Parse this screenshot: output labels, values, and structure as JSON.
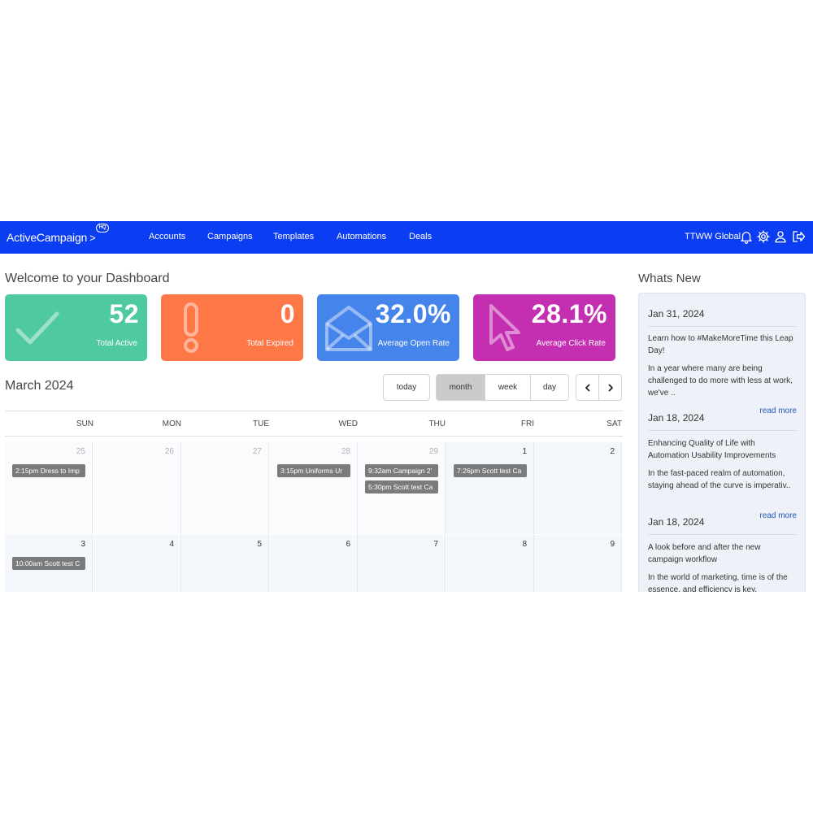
{
  "nav": {
    "brand": "ActiveCampaign",
    "brand_chevron": ">",
    "badge": "HQ",
    "links": [
      "Accounts",
      "Campaigns",
      "Templates",
      "Automations",
      "Deals"
    ],
    "org": "TTWW Global",
    "icons": [
      "bell-icon",
      "gear-icon",
      "user-icon",
      "logout-icon"
    ]
  },
  "dashboard": {
    "title": "Welcome to your Dashboard",
    "cards": [
      {
        "value": "52",
        "label": "Total Active",
        "color": "#4fc9a1",
        "icon": "checkmark-icon"
      },
      {
        "value": "0",
        "label": "Total Expired",
        "color": "#fd7846",
        "icon": "exclamation-icon"
      },
      {
        "value": "32.0%",
        "label": "Average Open Rate",
        "color": "#4584ea",
        "icon": "envelope-open-icon"
      },
      {
        "value": "28.1%",
        "label": "Average Click Rate",
        "color": "#c32fb0",
        "icon": "cursor-pointer-icon"
      }
    ]
  },
  "calendar": {
    "title": "March 2024",
    "buttons": {
      "today": "today",
      "month": "month",
      "week": "week",
      "day": "day"
    },
    "nav_icons": [
      "chevron-left-icon",
      "chevron-right-icon"
    ],
    "weekdays": [
      "SUN",
      "MON",
      "TUE",
      "WED",
      "THU",
      "FRI",
      "SAT"
    ],
    "weeks": [
      [
        {
          "day": "25",
          "other": true,
          "events": [
            "2:15pm Dress to Imp"
          ]
        },
        {
          "day": "26",
          "other": true,
          "events": []
        },
        {
          "day": "27",
          "other": true,
          "events": []
        },
        {
          "day": "28",
          "other": true,
          "events": [
            "3:15pm Uniforms Ur"
          ]
        },
        {
          "day": "29",
          "other": true,
          "events": [
            "9:32am Campaign 2'",
            "5:30pm Scott test Ca"
          ]
        },
        {
          "day": "1",
          "other": false,
          "events": [
            "7:26pm Scott test Ca"
          ]
        },
        {
          "day": "2",
          "other": false,
          "events": []
        }
      ],
      [
        {
          "day": "3",
          "other": false,
          "events": [
            "10:00am Scott test C"
          ]
        },
        {
          "day": "4",
          "other": false,
          "events": []
        },
        {
          "day": "5",
          "other": false,
          "events": []
        },
        {
          "day": "6",
          "other": false,
          "events": []
        },
        {
          "day": "7",
          "other": false,
          "events": []
        },
        {
          "day": "8",
          "other": false,
          "events": []
        },
        {
          "day": "9",
          "other": false,
          "events": []
        }
      ]
    ]
  },
  "whats_new": {
    "title": "Whats New",
    "posts": [
      {
        "date": "Jan 31, 2024",
        "headline": "Learn how to #MakeMoreTime this Leap Day!",
        "excerpt": "In a year where many are being challenged to do more with less at work, we've ..",
        "read_more": "read more"
      },
      {
        "date": "Jan 18, 2024",
        "headline": "Enhancing Quality of Life with Automation Usability Improvements",
        "excerpt": "In the fast-paced realm of automation, staying ahead of the curve is imperativ..",
        "read_more": "read more"
      },
      {
        "date": "Jan 18, 2024",
        "headline": "A look before and after the new campaign workflow",
        "excerpt": "In the world of marketing, time is of the essence, and efficiency is key.",
        "read_more": ""
      }
    ]
  }
}
